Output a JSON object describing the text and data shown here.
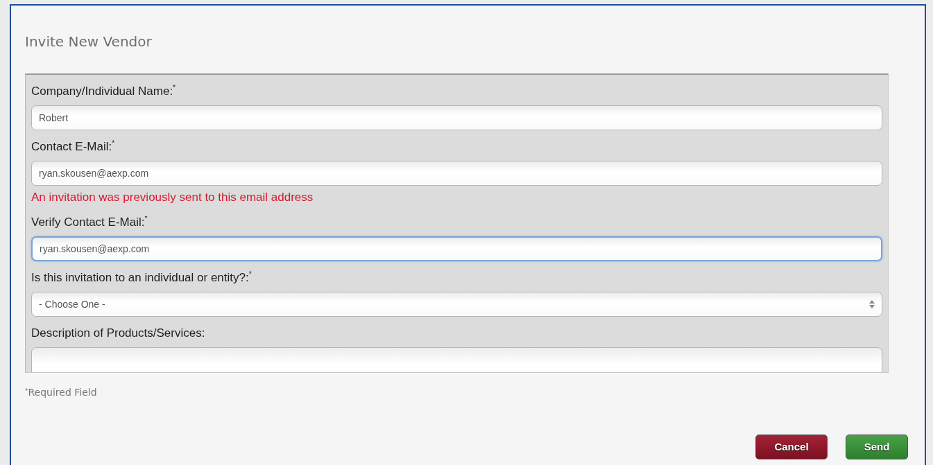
{
  "dialog": {
    "title": "Invite New Vendor"
  },
  "fields": [
    {
      "kind": "input",
      "label": "Company/Individual Name:$^{*}$",
      "value": "Robert",
      "focused": false
    },
    {
      "kind": "input",
      "label": "Contact E-Mail:$^{*}$",
      "value": "ryan.skousen@aexp.com",
      "focused": false,
      "error": "An invitation was previously sent to this email address"
    },
    {
      "kind": "input",
      "label": "Verify Contact E-Mail:$^{*}$",
      "value": "ryan.skousen@aexp.com",
      "focused": true
    },
    {
      "kind": "select",
      "label": "Is this invitation to an individual or entity?:$^{*}$",
      "value": "- Choose One -",
      "focused": false
    },
    {
      "kind": "textarea",
      "label": "Description of Products/Services:",
      "focused": false
    }
  ],
  "required_note": "$^{*}$Required Field",
  "buttons": [
    {
      "kind": "cancel",
      "label": "Cancel"
    },
    {
      "kind": "send",
      "label": "Send"
    }
  ]
}
